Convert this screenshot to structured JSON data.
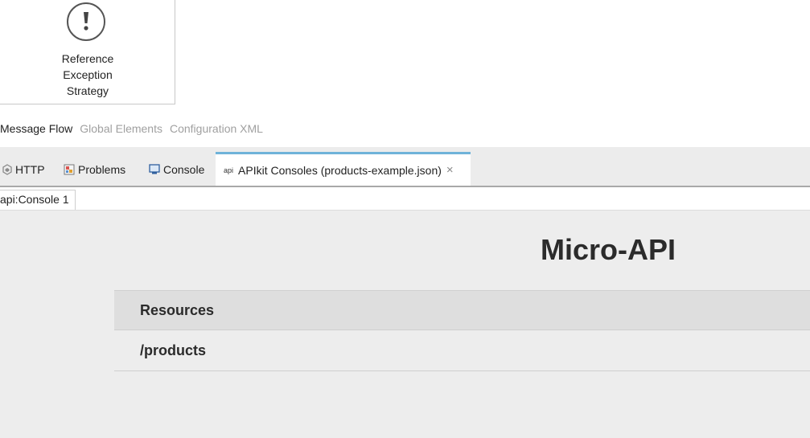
{
  "palette": {
    "strategy_lines": [
      "Reference",
      "Exception",
      "Strategy"
    ]
  },
  "editor_tabs": [
    {
      "label": "Message Flow",
      "active": true
    },
    {
      "label": "Global Elements",
      "active": false
    },
    {
      "label": "Configuration XML",
      "active": false
    }
  ],
  "view_tabs": [
    {
      "label": "HTTP",
      "icon": "http-icon"
    },
    {
      "label": "Problems",
      "icon": "problems-icon"
    },
    {
      "label": "Console",
      "icon": "console-icon"
    },
    {
      "label": "APIkit Consoles (products-example.json)",
      "icon": "api-icon",
      "icon_text": "api",
      "active": true,
      "close": "×"
    }
  ],
  "console_tab": {
    "label": "api:Console 1"
  },
  "console": {
    "title": "Micro-API",
    "resources_header": "Resources",
    "resources": [
      "/products"
    ]
  },
  "colors": {
    "active_tab_border": "#6fb3d9",
    "panel_background": "#ededed",
    "header_background": "#dedede"
  }
}
